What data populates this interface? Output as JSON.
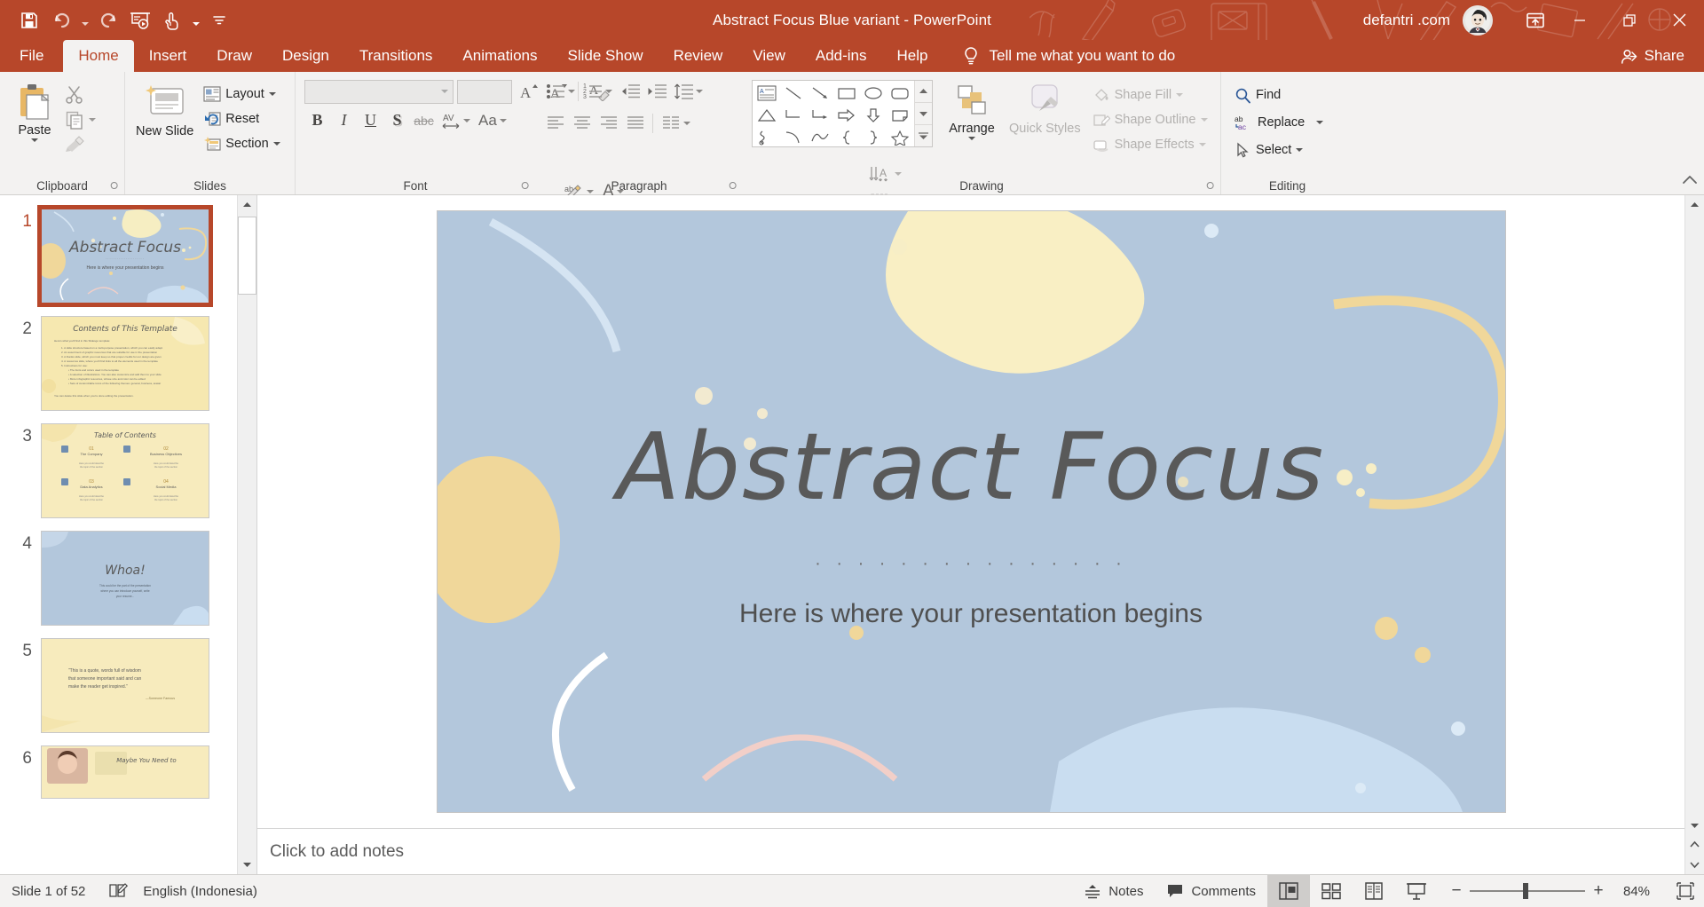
{
  "titlebar": {
    "quick_access": [
      {
        "name": "save-button",
        "label": "Save"
      },
      {
        "name": "undo-button",
        "label": "Undo"
      },
      {
        "name": "redo-button",
        "label": "Redo"
      },
      {
        "name": "start-from-beginning-button",
        "label": "Start From Beginning"
      },
      {
        "name": "touch-mouse-mode-button",
        "label": "Touch/Mouse Mode"
      },
      {
        "name": "customize-quick-access-toolbar-button",
        "label": "Customize Quick Access Toolbar"
      }
    ],
    "document_name": "Abstract Focus Blue variant",
    "separator": "-",
    "app_name": "PowerPoint",
    "title_full": "Abstract Focus Blue variant  -  PowerPoint",
    "account": "defantri .com",
    "ribbon_display_options": "Ribbon Display Options",
    "minimize": "Minimize",
    "restore": "Restore Down",
    "close": "Close",
    "accent_color": "#b7472a"
  },
  "tabs": [
    {
      "label": "File",
      "active": false
    },
    {
      "label": "Home",
      "active": true
    },
    {
      "label": "Insert",
      "active": false
    },
    {
      "label": "Draw",
      "active": false
    },
    {
      "label": "Design",
      "active": false
    },
    {
      "label": "Transitions",
      "active": false
    },
    {
      "label": "Animations",
      "active": false
    },
    {
      "label": "Slide Show",
      "active": false
    },
    {
      "label": "Review",
      "active": false
    },
    {
      "label": "View",
      "active": false
    },
    {
      "label": "Add-ins",
      "active": false
    },
    {
      "label": "Help",
      "active": false
    }
  ],
  "tellme": {
    "label": "Tell me what you want to do",
    "icon": "lightbulb-icon"
  },
  "share": {
    "label": "Share",
    "icon": "share-person-icon"
  },
  "ribbon": {
    "groups": [
      {
        "name": "Clipboard",
        "paste": "Paste",
        "cut": "Cut",
        "copy": "Copy",
        "format_painter": "Format Painter"
      },
      {
        "name": "Slides",
        "new_slide": "New Slide",
        "layout": "Layout",
        "reset": "Reset",
        "section": "Section"
      },
      {
        "name": "Font",
        "font_name_value": "",
        "font_size_value": "",
        "increase_font": "Increase Font Size",
        "decrease_font": "Decrease Font Size",
        "clear_formatting": "Clear All Formatting",
        "bold": "B",
        "italic": "I",
        "underline": "U",
        "shadow": "S",
        "strikethrough": "abc",
        "character_spacing": "AV",
        "change_case": "Aa",
        "text_highlight": "Text Highlight Color",
        "font_color": "A"
      },
      {
        "name": "Paragraph",
        "bullets": "Bullets",
        "numbering": "Numbering",
        "decrease_indent": "Decrease List Level",
        "increase_indent": "Increase List Level",
        "line_spacing": "Line Spacing",
        "align_left": "Align Left",
        "align_center": "Center",
        "align_right": "Align Right",
        "justify": "Justify",
        "columns": "Columns",
        "text_direction": "Text Direction",
        "align_text": "Align Text",
        "convert_smartart": "Convert to SmartArt"
      },
      {
        "name": "Drawing",
        "shapes_gallery": "Shapes",
        "arrange": "Arrange",
        "quick_styles": "Quick Styles",
        "shape_fill": "Shape Fill",
        "shape_outline": "Shape Outline",
        "shape_effects": "Shape Effects"
      },
      {
        "name": "Editing",
        "find": "Find",
        "replace": "Replace",
        "select": "Select"
      }
    ],
    "collapse": "Collapse the Ribbon"
  },
  "thumbnails": {
    "slides": [
      {
        "number": "1",
        "selected": true,
        "kind": "title",
        "title": "Abstract Focus",
        "subtitle": "Here is where your presentation begins"
      },
      {
        "number": "2",
        "selected": false,
        "kind": "contents",
        "title": "Contents of This Template"
      },
      {
        "number": "3",
        "selected": false,
        "kind": "toc",
        "title": "Table of Contents",
        "items": [
          {
            "num": "01",
            "label": "The Company",
            "desc": "Here you could describe the topic of the section"
          },
          {
            "num": "02",
            "label": "Business Objectives",
            "desc": "Here you could describe the topic of the section"
          },
          {
            "num": "03",
            "label": "Data Analytics",
            "desc": "Here you could describe the topic of the section"
          },
          {
            "num": "04",
            "label": "Social Media",
            "desc": "Here you could describe the topic of the section"
          }
        ]
      },
      {
        "number": "4",
        "selected": false,
        "kind": "whoa",
        "title": "Whoa!",
        "subtitle": "This could be the part of the presentation where you can introduce yourself, write your resume..."
      },
      {
        "number": "5",
        "selected": false,
        "kind": "quote",
        "title": "“This is a quote, words full of wisdom that someone important said and can make the reader get inspired.”",
        "subtitle": "—Someone Famous"
      },
      {
        "number": "6",
        "selected": false,
        "kind": "photo",
        "title": "Maybe You Need to"
      }
    ]
  },
  "slide": {
    "title": "Abstract Focus",
    "dots": "· · · · · · · · · · · · · · ·",
    "subtitle": "Here is where your presentation begins",
    "background_color": "#b3c7dc"
  },
  "notes": {
    "placeholder": "Click to add notes"
  },
  "statusbar": {
    "slide_count": "Slide 1 of 52",
    "spellcheck_icon": "proofing-icon",
    "language": "English (Indonesia)",
    "notes": "Notes",
    "comments": "Comments",
    "views": [
      {
        "name": "normal-view",
        "label": "Normal",
        "active": true
      },
      {
        "name": "slide-sorter-view",
        "label": "Slide Sorter",
        "active": false
      },
      {
        "name": "reading-view",
        "label": "Reading View",
        "active": false
      },
      {
        "name": "slide-show-view",
        "label": "Slide Show",
        "active": false
      }
    ],
    "zoom_out": "−",
    "zoom_in": "+",
    "zoom_value": "84%",
    "fit_to_window": "Fit slide to current window"
  }
}
